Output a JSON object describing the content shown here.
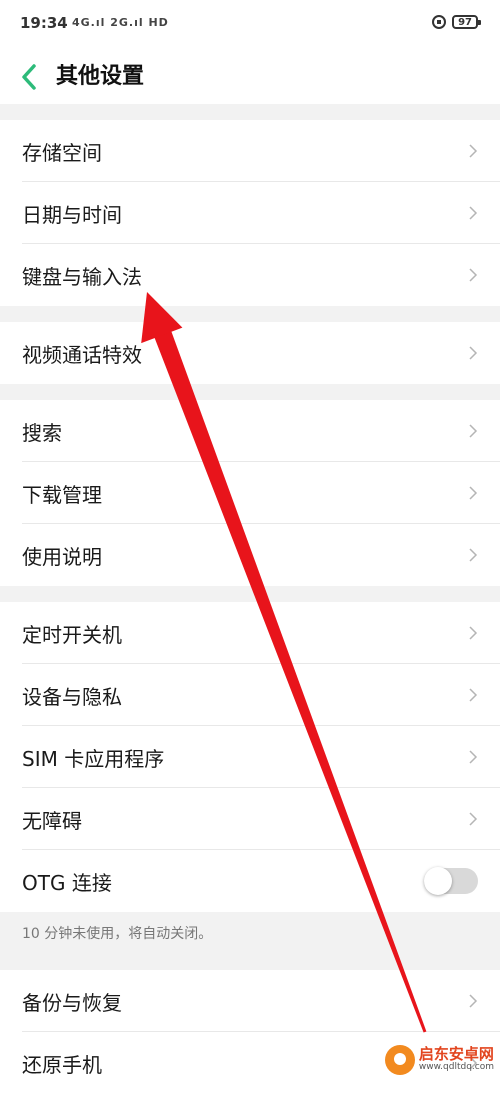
{
  "status_bar": {
    "time": "19:34",
    "signal": "4G.ıl 2G.ıl HD",
    "battery": "97"
  },
  "header": {
    "title": "其他设置",
    "accent_color": "#2dbb7a"
  },
  "groups": [
    {
      "items": [
        {
          "label": "存储空间"
        },
        {
          "label": "日期与时间"
        },
        {
          "label": "键盘与输入法"
        }
      ]
    },
    {
      "items": [
        {
          "label": "视频通话特效"
        }
      ]
    },
    {
      "items": [
        {
          "label": "搜索"
        },
        {
          "label": "下载管理"
        },
        {
          "label": "使用说明"
        }
      ]
    },
    {
      "items": [
        {
          "label": "定时开关机"
        },
        {
          "label": "设备与隐私"
        },
        {
          "label": "SIM 卡应用程序"
        },
        {
          "label": "无障碍"
        },
        {
          "label": "OTG 连接",
          "toggle": false
        }
      ],
      "note": "10 分钟未使用，将自动关闭。"
    },
    {
      "items": [
        {
          "label": "备份与恢复"
        },
        {
          "label": "还原手机"
        }
      ]
    }
  ],
  "annotation": {
    "arrow_color": "#e8141b",
    "target": "键盘与输入法"
  },
  "watermark": {
    "name": "启东安卓网",
    "url": "www.qdltdq.com",
    "logo_color": "#f28a1f"
  }
}
